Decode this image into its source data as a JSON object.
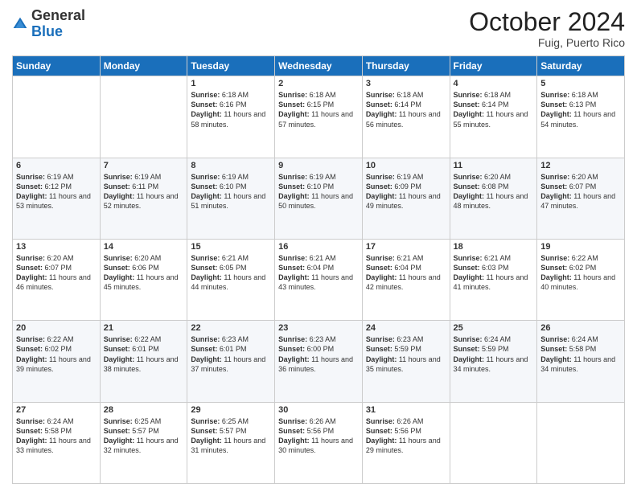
{
  "header": {
    "logo": {
      "general": "General",
      "blue": "Blue"
    },
    "month": "October 2024",
    "location": "Fuig, Puerto Rico"
  },
  "days_of_week": [
    "Sunday",
    "Monday",
    "Tuesday",
    "Wednesday",
    "Thursday",
    "Friday",
    "Saturday"
  ],
  "weeks": [
    [
      null,
      null,
      {
        "day": 1,
        "sunrise": "6:18 AM",
        "sunset": "6:16 PM",
        "daylight": "11 hours and 58 minutes."
      },
      {
        "day": 2,
        "sunrise": "6:18 AM",
        "sunset": "6:15 PM",
        "daylight": "11 hours and 57 minutes."
      },
      {
        "day": 3,
        "sunrise": "6:18 AM",
        "sunset": "6:14 PM",
        "daylight": "11 hours and 56 minutes."
      },
      {
        "day": 4,
        "sunrise": "6:18 AM",
        "sunset": "6:14 PM",
        "daylight": "11 hours and 55 minutes."
      },
      {
        "day": 5,
        "sunrise": "6:18 AM",
        "sunset": "6:13 PM",
        "daylight": "11 hours and 54 minutes."
      }
    ],
    [
      {
        "day": 6,
        "sunrise": "6:19 AM",
        "sunset": "6:12 PM",
        "daylight": "11 hours and 53 minutes."
      },
      {
        "day": 7,
        "sunrise": "6:19 AM",
        "sunset": "6:11 PM",
        "daylight": "11 hours and 52 minutes."
      },
      {
        "day": 8,
        "sunrise": "6:19 AM",
        "sunset": "6:10 PM",
        "daylight": "11 hours and 51 minutes."
      },
      {
        "day": 9,
        "sunrise": "6:19 AM",
        "sunset": "6:10 PM",
        "daylight": "11 hours and 50 minutes."
      },
      {
        "day": 10,
        "sunrise": "6:19 AM",
        "sunset": "6:09 PM",
        "daylight": "11 hours and 49 minutes."
      },
      {
        "day": 11,
        "sunrise": "6:20 AM",
        "sunset": "6:08 PM",
        "daylight": "11 hours and 48 minutes."
      },
      {
        "day": 12,
        "sunrise": "6:20 AM",
        "sunset": "6:07 PM",
        "daylight": "11 hours and 47 minutes."
      }
    ],
    [
      {
        "day": 13,
        "sunrise": "6:20 AM",
        "sunset": "6:07 PM",
        "daylight": "11 hours and 46 minutes."
      },
      {
        "day": 14,
        "sunrise": "6:20 AM",
        "sunset": "6:06 PM",
        "daylight": "11 hours and 45 minutes."
      },
      {
        "day": 15,
        "sunrise": "6:21 AM",
        "sunset": "6:05 PM",
        "daylight": "11 hours and 44 minutes."
      },
      {
        "day": 16,
        "sunrise": "6:21 AM",
        "sunset": "6:04 PM",
        "daylight": "11 hours and 43 minutes."
      },
      {
        "day": 17,
        "sunrise": "6:21 AM",
        "sunset": "6:04 PM",
        "daylight": "11 hours and 42 minutes."
      },
      {
        "day": 18,
        "sunrise": "6:21 AM",
        "sunset": "6:03 PM",
        "daylight": "11 hours and 41 minutes."
      },
      {
        "day": 19,
        "sunrise": "6:22 AM",
        "sunset": "6:02 PM",
        "daylight": "11 hours and 40 minutes."
      }
    ],
    [
      {
        "day": 20,
        "sunrise": "6:22 AM",
        "sunset": "6:02 PM",
        "daylight": "11 hours and 39 minutes."
      },
      {
        "day": 21,
        "sunrise": "6:22 AM",
        "sunset": "6:01 PM",
        "daylight": "11 hours and 38 minutes."
      },
      {
        "day": 22,
        "sunrise": "6:23 AM",
        "sunset": "6:01 PM",
        "daylight": "11 hours and 37 minutes."
      },
      {
        "day": 23,
        "sunrise": "6:23 AM",
        "sunset": "6:00 PM",
        "daylight": "11 hours and 36 minutes."
      },
      {
        "day": 24,
        "sunrise": "6:23 AM",
        "sunset": "5:59 PM",
        "daylight": "11 hours and 35 minutes."
      },
      {
        "day": 25,
        "sunrise": "6:24 AM",
        "sunset": "5:59 PM",
        "daylight": "11 hours and 34 minutes."
      },
      {
        "day": 26,
        "sunrise": "6:24 AM",
        "sunset": "5:58 PM",
        "daylight": "11 hours and 34 minutes."
      }
    ],
    [
      {
        "day": 27,
        "sunrise": "6:24 AM",
        "sunset": "5:58 PM",
        "daylight": "11 hours and 33 minutes."
      },
      {
        "day": 28,
        "sunrise": "6:25 AM",
        "sunset": "5:57 PM",
        "daylight": "11 hours and 32 minutes."
      },
      {
        "day": 29,
        "sunrise": "6:25 AM",
        "sunset": "5:57 PM",
        "daylight": "11 hours and 31 minutes."
      },
      {
        "day": 30,
        "sunrise": "6:26 AM",
        "sunset": "5:56 PM",
        "daylight": "11 hours and 30 minutes."
      },
      {
        "day": 31,
        "sunrise": "6:26 AM",
        "sunset": "5:56 PM",
        "daylight": "11 hours and 29 minutes."
      },
      null,
      null
    ]
  ],
  "labels": {
    "sunrise": "Sunrise:",
    "sunset": "Sunset:",
    "daylight": "Daylight:"
  }
}
